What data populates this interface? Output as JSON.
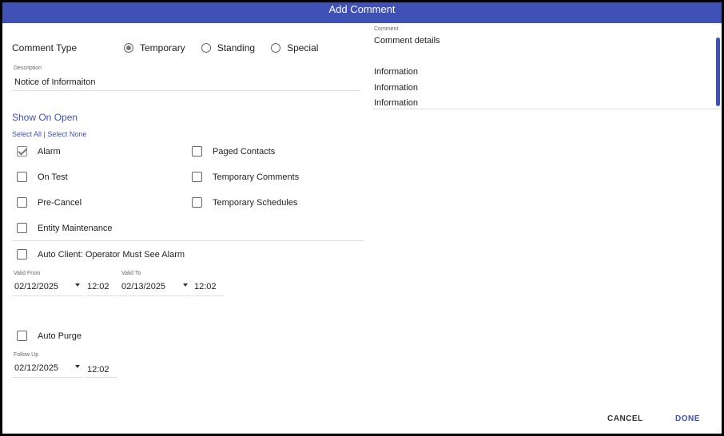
{
  "dialog": {
    "title": "Add Comment"
  },
  "comment_type": {
    "label": "Comment Type",
    "options": [
      {
        "label": "Temporary",
        "checked": true
      },
      {
        "label": "Standing",
        "checked": false
      },
      {
        "label": "Special",
        "checked": false
      }
    ]
  },
  "description": {
    "caption": "Description",
    "value": "Notice of Informaiton"
  },
  "show_on_open": {
    "title": "Show On Open",
    "select_all": "Select All",
    "separator": "|",
    "select_none": "Select None",
    "items": [
      {
        "label": "Alarm",
        "checked": true
      },
      {
        "label": "On Test",
        "checked": false
      },
      {
        "label": "Pre-Cancel",
        "checked": false
      },
      {
        "label": "Entity Maintenance",
        "checked": false
      },
      {
        "label": "Paged Contacts",
        "checked": false
      },
      {
        "label": "Temporary Comments",
        "checked": false
      },
      {
        "label": "Temporary Schedules",
        "checked": false
      }
    ]
  },
  "auto_client": {
    "label": "Auto Client: Operator Must See Alarm",
    "checked": false
  },
  "valid_from": {
    "caption": "Valid From",
    "date": "02/12/2025",
    "time": "12:02"
  },
  "valid_to": {
    "caption": "Valid To",
    "date": "02/13/2025",
    "time": "12:02"
  },
  "auto_purge": {
    "label": "Auto Purge",
    "checked": false
  },
  "follow_up": {
    "caption": "Follow Up",
    "date": "02/12/2025",
    "time": "12:02"
  },
  "comment": {
    "caption": "Comment",
    "lines": [
      "Comment details",
      "",
      "Information",
      "Information",
      "Information"
    ]
  },
  "actions": {
    "cancel": "CANCEL",
    "done": "DONE"
  },
  "colors": {
    "accent": "#3f51b5",
    "text": "#222222"
  }
}
